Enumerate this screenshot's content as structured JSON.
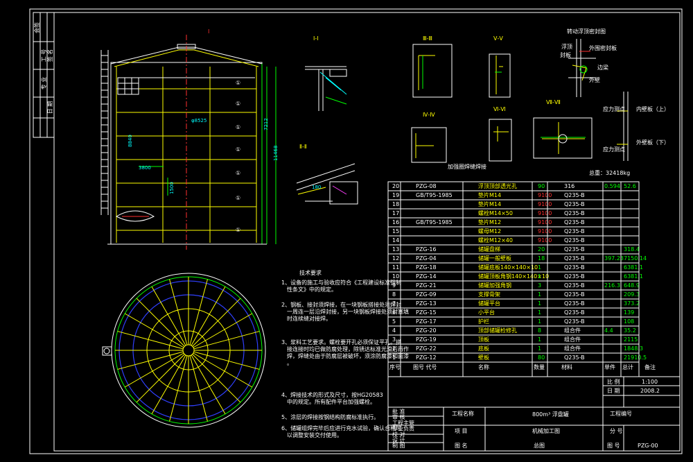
{
  "notes": {
    "title": "技术要求",
    "items": [
      "1、设备的施工与验收应符合《工程建设标准强制性条文》中的规定。",
      "2、钢板、接封须焊接，在一块钢板搭接处须焊封一周连一层沿焊封接，另一块钢板焊接处须封塞填时连续缝对接焊。",
      "3、浆料工艺要求。螺栓要开孔必须保证平孔。搭接连接时均已做防腐处理，除锈达标准光滑后再作焊，焊缝处由于防腐层被破坏，须涂防腐漆和面漆。",
      "4、焊接技术的形式及尺寸，按HG20583 中的规定。所有配件平台加强螺栓。",
      "5、涂层的焊接按钢结构防腐标准执行。",
      "6、储罐组焊完毕后应进行充水试验，确认合格可以调整安装交付使用。"
    ]
  },
  "weight": "总重：32418kg",
  "section_labels": [
    "I-I",
    "Ⅱ-Ⅱ",
    "Ⅲ-Ⅲ",
    "Ⅳ-Ⅳ",
    "Ⅴ-Ⅴ",
    "Ⅵ-Ⅵ",
    "Ⅶ-Ⅶ"
  ],
  "detail_labels": {
    "detail_title": "转动浮顶密封图",
    "a": "浮顶",
    "b": "外围密封板",
    "c": "封板",
    "d": "边梁",
    "e": "外壁",
    "f": "内壁板（上）",
    "g": "外壁板（下）",
    "h": "应力测点",
    "i": "应力测点",
    "k": "加强圈焊缝焊接"
  },
  "elevation_dims": {
    "d1": "φ8525",
    "d2": "7212",
    "d3": "11468",
    "d4": "8840",
    "d5": "3800",
    "d6": "1500",
    "tag": "I"
  },
  "bom": {
    "columns": [
      "序号",
      "图号 代号",
      "名称",
      "数量",
      "材料",
      "单件",
      "总计",
      "备注"
    ],
    "rows": [
      {
        "no": "20",
        "code": "PZG-08",
        "name": "浮顶顶部透光孔",
        "qty": "90",
        "mat": "316",
        "unit": "0.594",
        "total": "52.6",
        "q_red": false
      },
      {
        "no": "19",
        "code": "GB/T95-1985",
        "name": "垫片M14",
        "qty": "9100",
        "mat": "Q235-B",
        "unit": "",
        "total": "",
        "q_red": true
      },
      {
        "no": "18",
        "code": "",
        "name": "垫片M14",
        "qty": "9100",
        "mat": "Q235-B",
        "unit": "",
        "total": "",
        "q_red": true
      },
      {
        "no": "17",
        "code": "",
        "name": "螺栓M14×50",
        "qty": "9100",
        "mat": "Q235-B",
        "unit": "",
        "total": "",
        "q_red": true
      },
      {
        "no": "16",
        "code": "GB/T95-1985",
        "name": "垫片M12",
        "qty": "9100",
        "mat": "Q235-B",
        "unit": "",
        "total": "",
        "q_red": true
      },
      {
        "no": "15",
        "code": "",
        "name": "螺母M12",
        "qty": "9100",
        "mat": "Q235-B",
        "unit": "",
        "total": "",
        "q_red": true
      },
      {
        "no": "14",
        "code": "",
        "name": "螺栓M12×40",
        "qty": "9100",
        "mat": "Q235-B",
        "unit": "",
        "total": "",
        "q_red": true
      },
      {
        "no": "13",
        "code": "PZG-16",
        "name": "储罐盘梯",
        "qty": "20",
        "mat": "Q235-B",
        "unit": "",
        "total": "318.4",
        "q_red": false
      },
      {
        "no": "12",
        "code": "PZG-04",
        "name": "储罐一般壁板",
        "qty": "18",
        "mat": "Q235-B",
        "unit": "397.23",
        "total": "7150.14",
        "q_red": false
      },
      {
        "no": "11",
        "code": "PZG-18",
        "name": "储罐底板140×140×10",
        "qty": "1",
        "mat": "Q235-B",
        "unit": "",
        "total": "6381.1",
        "q_red": false
      },
      {
        "no": "10",
        "code": "PZG-14",
        "name": "储罐顶板角钢140×140×10",
        "qty": "1",
        "mat": "Q235-B",
        "unit": "",
        "total": "6381.1",
        "q_red": false
      },
      {
        "no": "9",
        "code": "PZG-21",
        "name": "储罐加强角钢",
        "qty": "3",
        "mat": "Q235-B",
        "unit": "216.3",
        "total": "648.9",
        "q_red": false
      },
      {
        "no": "8",
        "code": "PZG-09",
        "name": "支撑骨架",
        "qty": "1",
        "mat": "Q235-B",
        "unit": "",
        "total": "209.3",
        "q_red": false
      },
      {
        "no": "7",
        "code": "PZG-13",
        "name": "储罐平台",
        "qty": "1",
        "mat": "Q235-B",
        "unit": "",
        "total": "373.2",
        "q_red": false
      },
      {
        "no": "6",
        "code": "PZG-15",
        "name": "小平台",
        "qty": "1",
        "mat": "Q235-B",
        "unit": "",
        "total": "139",
        "q_red": false
      },
      {
        "no": "5",
        "code": "PZG-17",
        "name": "护栏",
        "qty": "1",
        "mat": "Q235-B",
        "unit": "",
        "total": "108",
        "q_red": false
      },
      {
        "no": "4",
        "code": "PZG-20",
        "name": "顶部储罐检修孔",
        "qty": "8",
        "mat": "组合件",
        "unit": "4.4",
        "total": "35.2",
        "q_red": false
      },
      {
        "no": "3",
        "code": "PZG-19",
        "name": "顶板",
        "qty": "1",
        "mat": "组合件",
        "unit": "",
        "total": "2115",
        "q_red": false
      },
      {
        "no": "2",
        "code": "PZG-22",
        "name": "底板",
        "qty": "1",
        "mat": "组合件",
        "unit": "",
        "total": "1848.3",
        "q_red": false
      },
      {
        "no": "1",
        "code": "PZG-12",
        "name": "壁板",
        "qty": "80",
        "mat": "Q235-B",
        "unit": "",
        "total": "21910.5",
        "q_red": false
      }
    ]
  },
  "title_block": {
    "scale_label": "比 例",
    "scale": "1:100",
    "date_label": "日 期",
    "date": "2008.2",
    "project_label": "工程名称",
    "project": "800m³ 浮盘罐",
    "project_no_label": "工程编号",
    "item_label": "项 目",
    "item": "机械加工图",
    "drawing_label": "图 名",
    "drawing": "总图",
    "part_label": "分 号",
    "fig_label": "图 号",
    "fig": "PZG-00",
    "roles": [
      "批 准",
      "审 核",
      "工程主管",
      "专业负责",
      "校 对",
      "设 计",
      "制 图"
    ]
  },
  "left_strip": [
    "会签",
    "工 号",
    "专 业",
    "签 名",
    "日 期"
  ]
}
